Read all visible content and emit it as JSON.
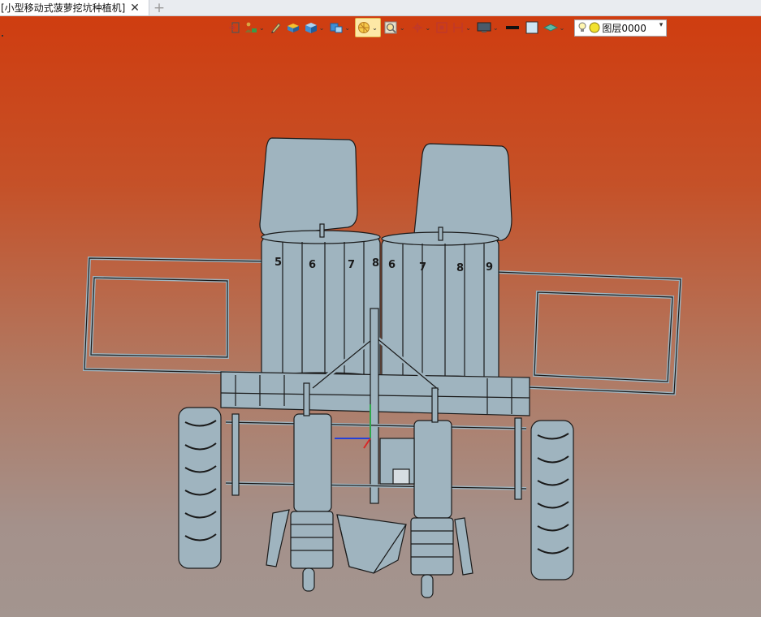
{
  "tab": {
    "title": "[小型移动式菠萝挖坑种植机]",
    "close": "✕",
    "add": "+"
  },
  "toolbar": {
    "icons": [
      "exit-icon",
      "person-paint-icon",
      "pen-icon",
      "box-solid-icon",
      "cube-icon",
      "cube-view-icon",
      "render-style-icon",
      "zoom-icon",
      "rotate-icon",
      "zoom-fit-icon",
      "section-icon",
      "display-icon",
      "line-color-icon",
      "fill-color-icon",
      "material-icon"
    ],
    "layer": {
      "label": "图层0000",
      "status_icons": [
        "bulb-icon",
        "circle-yellow-icon"
      ]
    }
  },
  "colors": {
    "background_top": "#cf3d10",
    "background_bottom": "#a3958f",
    "model_fill": "#9fb4bf",
    "model_line": "#1a1a1a",
    "active_tool": "#fde8a6"
  },
  "model": {
    "left_hopper_numbers": [
      "5",
      "6",
      "7",
      "8"
    ],
    "right_hopper_numbers": [
      "6",
      "7",
      "8",
      "9"
    ]
  }
}
